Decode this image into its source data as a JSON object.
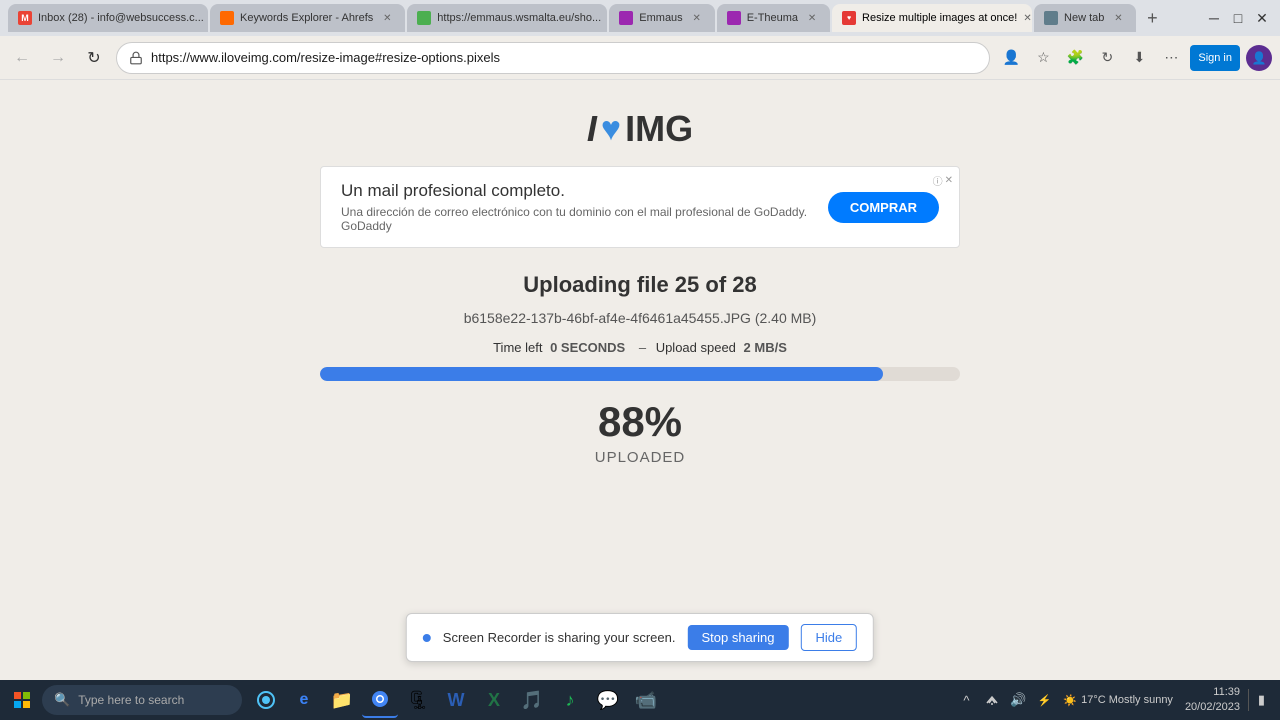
{
  "browser": {
    "url": "https://www.iloveimg.com/resize-image#resize-options.pixels",
    "tabs": [
      {
        "id": "tab-gmail",
        "label": "Inbox (28) - info@websuccess.c...",
        "favicon": "gmail",
        "active": false
      },
      {
        "id": "tab-ahrefs",
        "label": "Keywords Explorer - Ahrefs",
        "favicon": "ahrefs",
        "active": false
      },
      {
        "id": "tab-emmaus",
        "label": "https://emmaus.wsmalta.eu/sho...",
        "favicon": "emmaus",
        "active": false
      },
      {
        "id": "tab-etheuma",
        "label": "Emmaus",
        "favicon": "etheuma",
        "active": false
      },
      {
        "id": "tab-etheuma2",
        "label": "E-Theuma",
        "favicon": "etheuma",
        "active": false
      },
      {
        "id": "tab-iloveimg",
        "label": "Resize multiple images at once!",
        "favicon": "iloveimg",
        "active": true
      },
      {
        "id": "tab-newtab",
        "label": "New tab",
        "favicon": "newtab",
        "active": false
      }
    ]
  },
  "page": {
    "logo": {
      "i": "I",
      "heart": "♥",
      "img": "IMG"
    },
    "ad": {
      "title": "Un mail profesional completo.",
      "subtitle": "Una dirección de correo electrónico con tu dominio con el mail profesional de GoDaddy. GoDaddy",
      "button_label": "COMPRAR"
    },
    "upload": {
      "title": "Uploading file 25 of 28",
      "filename": "b6158e22-137b-46bf-af4e-4f6461a45455.JPG (2.40 MB)",
      "time_left_label": "Time left",
      "time_left_value": "0 SECONDS",
      "speed_label": "Upload speed",
      "speed_value": "2 MB/S",
      "progress_percent": 88,
      "percent_display": "88%",
      "uploaded_label": "UPLOADED"
    }
  },
  "screen_recorder": {
    "message": "Screen Recorder is sharing your screen.",
    "stop_button": "Stop sharing",
    "hide_button": "Hide"
  },
  "taskbar": {
    "search_placeholder": "Type here to search",
    "time": "11:39",
    "date": "20/02/2023",
    "weather": "17°C  Mostly sunny"
  }
}
